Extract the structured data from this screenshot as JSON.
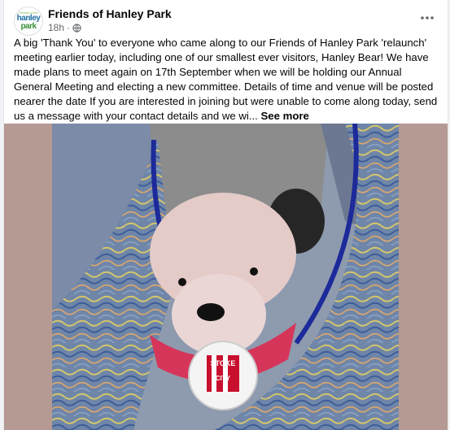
{
  "post": {
    "page_name": "Friends of Hanley Park",
    "time": "18h",
    "separator": "·",
    "avatar": {
      "line1": "friends of the",
      "line2": "hanley",
      "line3": "park"
    },
    "text_main": "A big 'Thank You' to everyone who came along to our Friends of Hanley Park 'relaunch' meeting earlier today, including one of our smallest ever visitors, Hanley Bear! We have made plans to meet again on 17th September when we will be holding our Annual General Meeting and electing a new committee. Details of time and venue will be posted nearer the date  If you are interested in joining but were unable to come along today, send us a message with your contact details and we wi...",
    "see_more": "See more",
    "icons": {
      "audience": "globe-icon",
      "menu": "more-options-icon"
    },
    "photo": {
      "badge_text_1": "STOKE",
      "badge_text_2": "CITY"
    }
  },
  "colors": {
    "photo_background": "#b49a92",
    "text": "#050505",
    "meta": "#65676b"
  }
}
